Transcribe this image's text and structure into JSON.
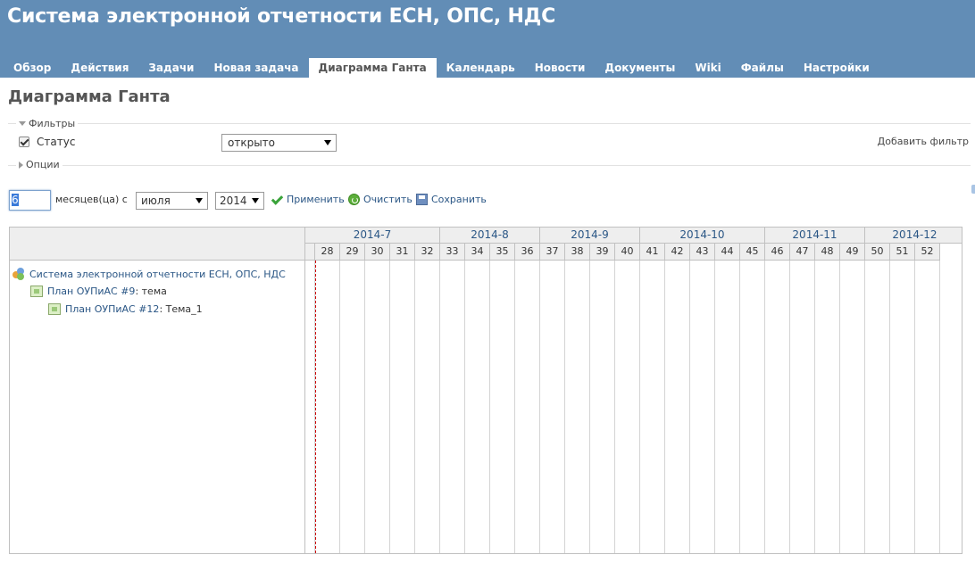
{
  "header": {
    "title": "Система электронной отчетности ЕСН, ОПС, НДС"
  },
  "menu": {
    "items": [
      {
        "label": "Обзор"
      },
      {
        "label": "Действия"
      },
      {
        "label": "Задачи"
      },
      {
        "label": "Новая задача"
      },
      {
        "label": "Диаграмма Ганта",
        "selected": true
      },
      {
        "label": "Календарь"
      },
      {
        "label": "Новости"
      },
      {
        "label": "Документы"
      },
      {
        "label": "Wiki"
      },
      {
        "label": "Файлы"
      },
      {
        "label": "Настройки"
      }
    ]
  },
  "page": {
    "title": "Диаграмма Ганта"
  },
  "filters": {
    "legend": "Фильтры",
    "status_label": "Статус",
    "status_checked": true,
    "status_value": "открыто",
    "add_filter_label": "Добавить фильтр"
  },
  "options": {
    "legend": "Опции"
  },
  "period": {
    "months_value": "6",
    "months_label": "месяцев(ца) с",
    "month_value": "июля",
    "year_value": "2014",
    "apply_label": "Применить",
    "clear_label": "Очистить",
    "save_label": "Сохранить"
  },
  "gantt": {
    "subjects": [
      {
        "type": "project",
        "link": "Система электронной отчетности ЕСН, ОПС, НДС",
        "suffix": ""
      },
      {
        "type": "task",
        "link": "План ОУПиАС #9",
        "suffix": ": тема"
      },
      {
        "type": "task",
        "link": "План ОУПиАС #12",
        "suffix": ": Тема_1"
      }
    ],
    "months": [
      {
        "label": "2014-7",
        "weeks": 5
      },
      {
        "label": "2014-8",
        "weeks": 4
      },
      {
        "label": "2014-9",
        "weeks": 4
      },
      {
        "label": "2014-10",
        "weeks": 5
      },
      {
        "label": "2014-11",
        "weeks": 4
      },
      {
        "label": "2014-12",
        "weeks": 4
      }
    ],
    "weeks": [
      "",
      "28",
      "29",
      "30",
      "31",
      "32",
      "33",
      "34",
      "35",
      "36",
      "37",
      "38",
      "39",
      "40",
      "41",
      "42",
      "43",
      "44",
      "45",
      "46",
      "47",
      "48",
      "49",
      "50",
      "51",
      "52"
    ]
  },
  "colors": {
    "header_bg": "#628db6",
    "link": "#2a5685",
    "today_line": "#cc0000"
  }
}
